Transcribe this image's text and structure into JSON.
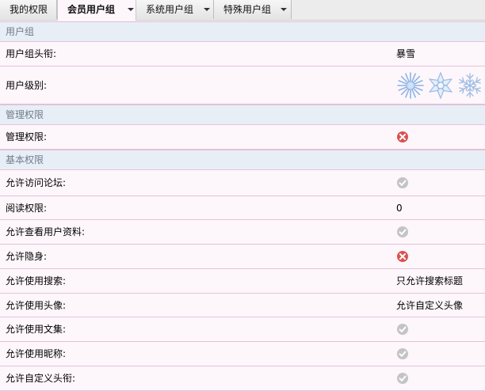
{
  "tabs": [
    {
      "label": "我的权限"
    },
    {
      "label": "会员用户组"
    },
    {
      "label": "系统用户组"
    },
    {
      "label": "特殊用户组"
    }
  ],
  "sections": {
    "user_group": "用户组",
    "admin": "管理权限",
    "basic": "基本权限"
  },
  "rows": {
    "group_title": {
      "label": "用户组头衔:",
      "value": "暴雪"
    },
    "group_level": {
      "label": "用户级别:",
      "icons": [
        "snowflake-icon",
        "snowflake-icon",
        "snowflake-icon"
      ]
    },
    "admin_perm": {
      "label": "管理权限:",
      "state": "denied"
    },
    "visit_forum": {
      "label": "允许访问论坛:",
      "state": "allowed"
    },
    "read_perm": {
      "label": "阅读权限:",
      "value": "0"
    },
    "view_profile": {
      "label": "允许查看用户资料:",
      "state": "allowed"
    },
    "invisible": {
      "label": "允许隐身:",
      "state": "denied"
    },
    "search": {
      "label": "允许使用搜索:",
      "value": "只允许搜索标题"
    },
    "avatar": {
      "label": "允许使用头像:",
      "value": "允许自定义头像"
    },
    "collection": {
      "label": "允许使用文集:",
      "state": "allowed"
    },
    "nickname": {
      "label": "允许使用昵称:",
      "state": "allowed"
    },
    "custom_title": {
      "label": "允许自定义头衔:",
      "state": "allowed"
    }
  },
  "colors": {
    "allowed": "#bcbcbc",
    "denied": "#d9534f",
    "row_border": "#e6c3db",
    "section_bg": "#e8eef6"
  }
}
